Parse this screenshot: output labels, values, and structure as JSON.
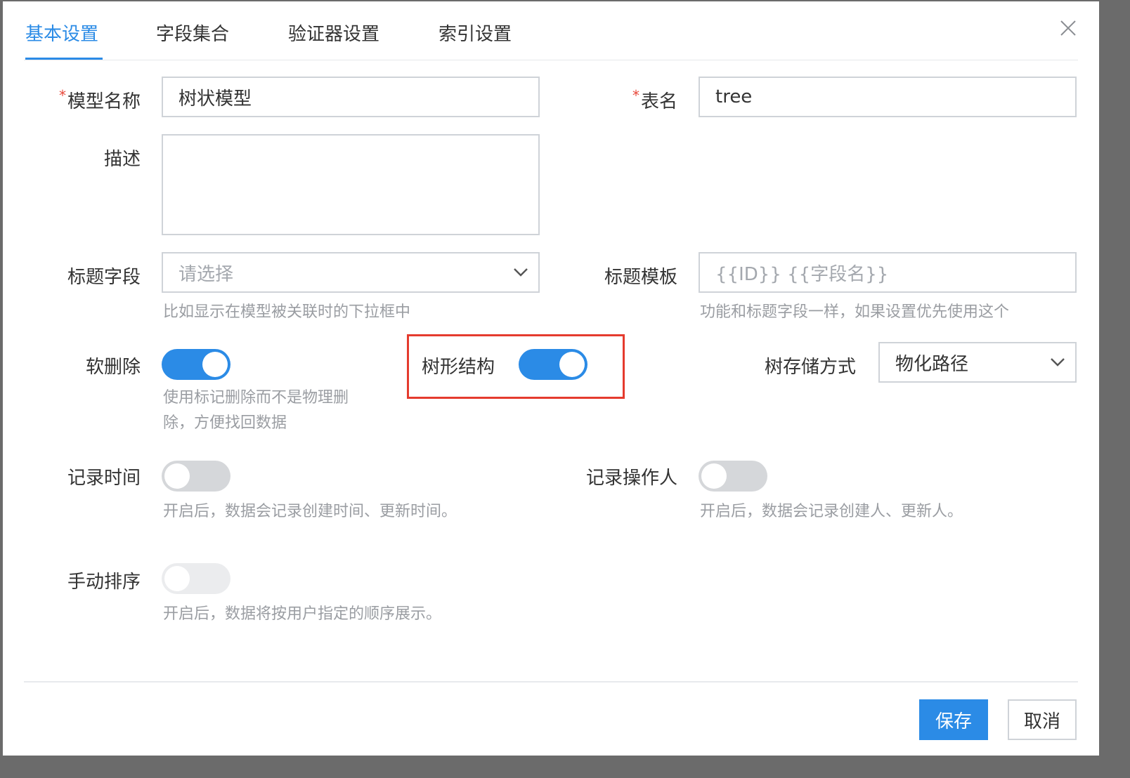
{
  "tabs": [
    {
      "label": "基本设置",
      "active": true
    },
    {
      "label": "字段集合"
    },
    {
      "label": "验证器设置"
    },
    {
      "label": "索引设置"
    }
  ],
  "form": {
    "required_mark": "*",
    "model_name": {
      "label": "模型名称",
      "value": "树状模型"
    },
    "table_name": {
      "label": "表名",
      "value": "tree"
    },
    "description": {
      "label": "描述",
      "value": ""
    },
    "title_field": {
      "label": "标题字段",
      "placeholder": "请选择",
      "hint": "比如显示在模型被关联时的下拉框中"
    },
    "title_template": {
      "label": "标题模板",
      "placeholder": "{{ID}} {{字段名}}",
      "hint": "功能和标题字段一样，如果设置优先使用这个"
    },
    "soft_delete": {
      "label": "软删除",
      "on": true,
      "hint_line1": "使用标记删除而不是物理删",
      "hint_line2": "除，方便找回数据"
    },
    "tree_structure": {
      "label": "树形结构",
      "on": true
    },
    "tree_storage": {
      "label": "树存储方式",
      "value": "物化路径"
    },
    "record_time": {
      "label": "记录时间",
      "on": false,
      "hint": "开启后，数据会记录创建时间、更新时间。"
    },
    "record_operator": {
      "label": "记录操作人",
      "on": false,
      "hint": "开启后，数据会记录创建人、更新人。"
    },
    "manual_sort": {
      "label": "手动排序",
      "on": false,
      "disabled": true,
      "hint": "开启后，数据将按用户指定的顺序展示。"
    }
  },
  "footer": {
    "save_label": "保存",
    "cancel_label": "取消"
  },
  "colors": {
    "primary": "#2b8be6",
    "highlight": "#e53b2e",
    "required": "#e8473a"
  },
  "icons": {
    "close": "close-icon",
    "dropdown": "chevron-down-icon"
  }
}
